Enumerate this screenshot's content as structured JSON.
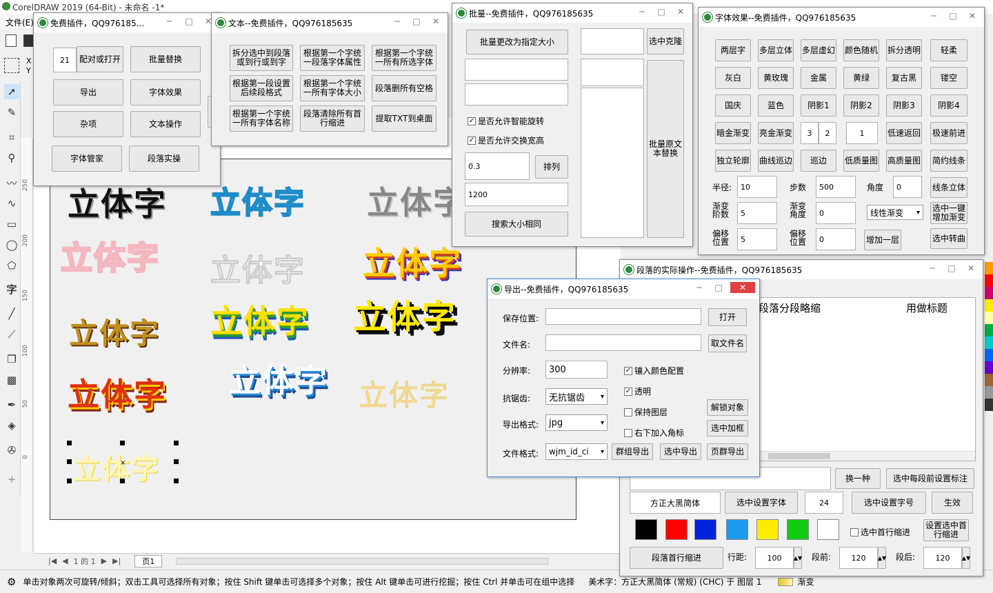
{
  "app": {
    "title": "CorelDRAW 2019 (64-Bit) - 未命名 -1*",
    "menu_file": "文件(E)",
    "page_tab": "页1",
    "page_nav": "1 的 1"
  },
  "status": {
    "left": "单击对象两次可旋转/倾斜；双击工具可选择所有对象；按住 Shift 键单击可选择多个对象；按住 Alt 键单击可进行挖掘；按住 Ctrl 并单击可在组中选择",
    "right": "美术字：方正大黑简体 (常规) (CHC) 于 图层 1",
    "fill_label": "渐变"
  },
  "ruler_labels": [
    "250",
    "200",
    "150",
    "100",
    "50",
    "0"
  ],
  "art_text": "立体字",
  "win_free": {
    "title": "免费插件，QQ976185...",
    "value": "21",
    "buttons": [
      "配对或打开",
      "批量替换",
      "导出",
      "字体效果",
      "杂项",
      "文本操作",
      "字体管家",
      "段落实操"
    ]
  },
  "win_text": {
    "title": "文本--免费插件，QQ976185635",
    "buttons": [
      "拆分选中到段落或到行或到字",
      "根据第一个字统一段落字体属性",
      "根据第一个字统一所有所选字体",
      "根据第一段设置后续段格式",
      "根据第一个字统一所有字体大小",
      "段落删所有空格",
      "根据第一个字统一所有字体名称",
      "段落清除所有首行缩进",
      "提取TXT到桌面"
    ]
  },
  "win_batch": {
    "title": "批量--免费插件，QQ976185635",
    "btn_resize": "批量更改为指定大小",
    "btn_clone": "选中克隆",
    "btn_replace": "批量原文本替换",
    "chk1": "是否允许智能旋转",
    "chk2": "是否允许交换宽高",
    "val1": "0.3",
    "btn_sort": "排列",
    "val2": "1200",
    "btn_search": "搜索大小相同"
  },
  "win_font": {
    "title": "字体效果--免费插件，QQ976185635",
    "row1": [
      "两层字",
      "多层立体",
      "多层虚幻",
      "颜色随机",
      "拆分透明",
      "轻柔"
    ],
    "row2": [
      "灰白",
      "黄玫瑰",
      "金属",
      "黄绿",
      "复古黑",
      "镂空"
    ],
    "row3": [
      "国庆",
      "蓝色",
      "阴影1",
      "阴影2",
      "阴影3",
      "阴影4"
    ],
    "row4": [
      "暗金渐变",
      "亮金渐变",
      "低速返回",
      "极速前进"
    ],
    "row4_vals": [
      "3",
      "2",
      "1"
    ],
    "row5": [
      "独立轮廓",
      "曲线巡边",
      "巡边",
      "低质量图",
      "高质量图",
      "简约线条"
    ],
    "radius_lbl": "半径:",
    "radius": "10",
    "steps_lbl": "步数",
    "steps": "500",
    "angle_lbl": "角度",
    "angle": "0",
    "btn_line3d": "线条立体",
    "grad_steps_lbl": "渐变阶数",
    "grad_steps": "5",
    "grad_angle_lbl": "渐变角度",
    "grad_angle": "0",
    "grad_type": "线性渐变",
    "btn_onekey": "选中一键增加渐变",
    "offset_lbl": "偏移位置",
    "offset1": "5",
    "offset2_lbl": "偏移位置",
    "offset2": "0",
    "btn_addlayer": "增加一层",
    "btn_curve": "选中转曲"
  },
  "win_para": {
    "title": "段落的实际操作--免费插件，QQ976185635",
    "col1": "段落分段略缩",
    "col2": "用做标题",
    "btn_swap": "换一种",
    "btn_mark": "选中每段前设置标注",
    "font": "方正大黑简体",
    "btn_setfont": "选中设置字体",
    "size": "24",
    "btn_setsize": "选中设置字号",
    "btn_apply": "生效",
    "colors": [
      "#000000",
      "#ff0000",
      "#0022dd",
      "#1d9bf0",
      "#ffee00",
      "#11cc11",
      "#ffffff"
    ],
    "chk_indent": "选中首行缩进",
    "btn_setindent": "设置选中首行缩进",
    "btn_paraindent": "段落首行缩进",
    "line_lbl": "行距:",
    "line": "100",
    "before_lbl": "段前:",
    "before": "120",
    "after_lbl": "段后:",
    "after": "120"
  },
  "win_export": {
    "title": "导出--免费插件，QQ976185635",
    "save_lbl": "保存位置:",
    "btn_open": "打开",
    "name_lbl": "文件名:",
    "btn_getname": "取文件名",
    "dpi_lbl": "分辨率:",
    "dpi": "300",
    "chk_embed": "镶入颜色配置",
    "chk_trans": "透明",
    "aa_lbl": "抗锯齿:",
    "aa": "无抗锯齿",
    "chk_layer": "保持图层",
    "btn_unlock": "解锁对象",
    "fmt_lbl": "导出格式:",
    "fmt": "jpg",
    "chk_corner": "右下加入角标",
    "btn_frame": "选中加框",
    "ftype_lbl": "文件格式:",
    "ftype": "wjm_id_ci",
    "btn_group": "群组导出",
    "btn_selexport": "选中导出",
    "btn_pageexport": "页群导出"
  }
}
